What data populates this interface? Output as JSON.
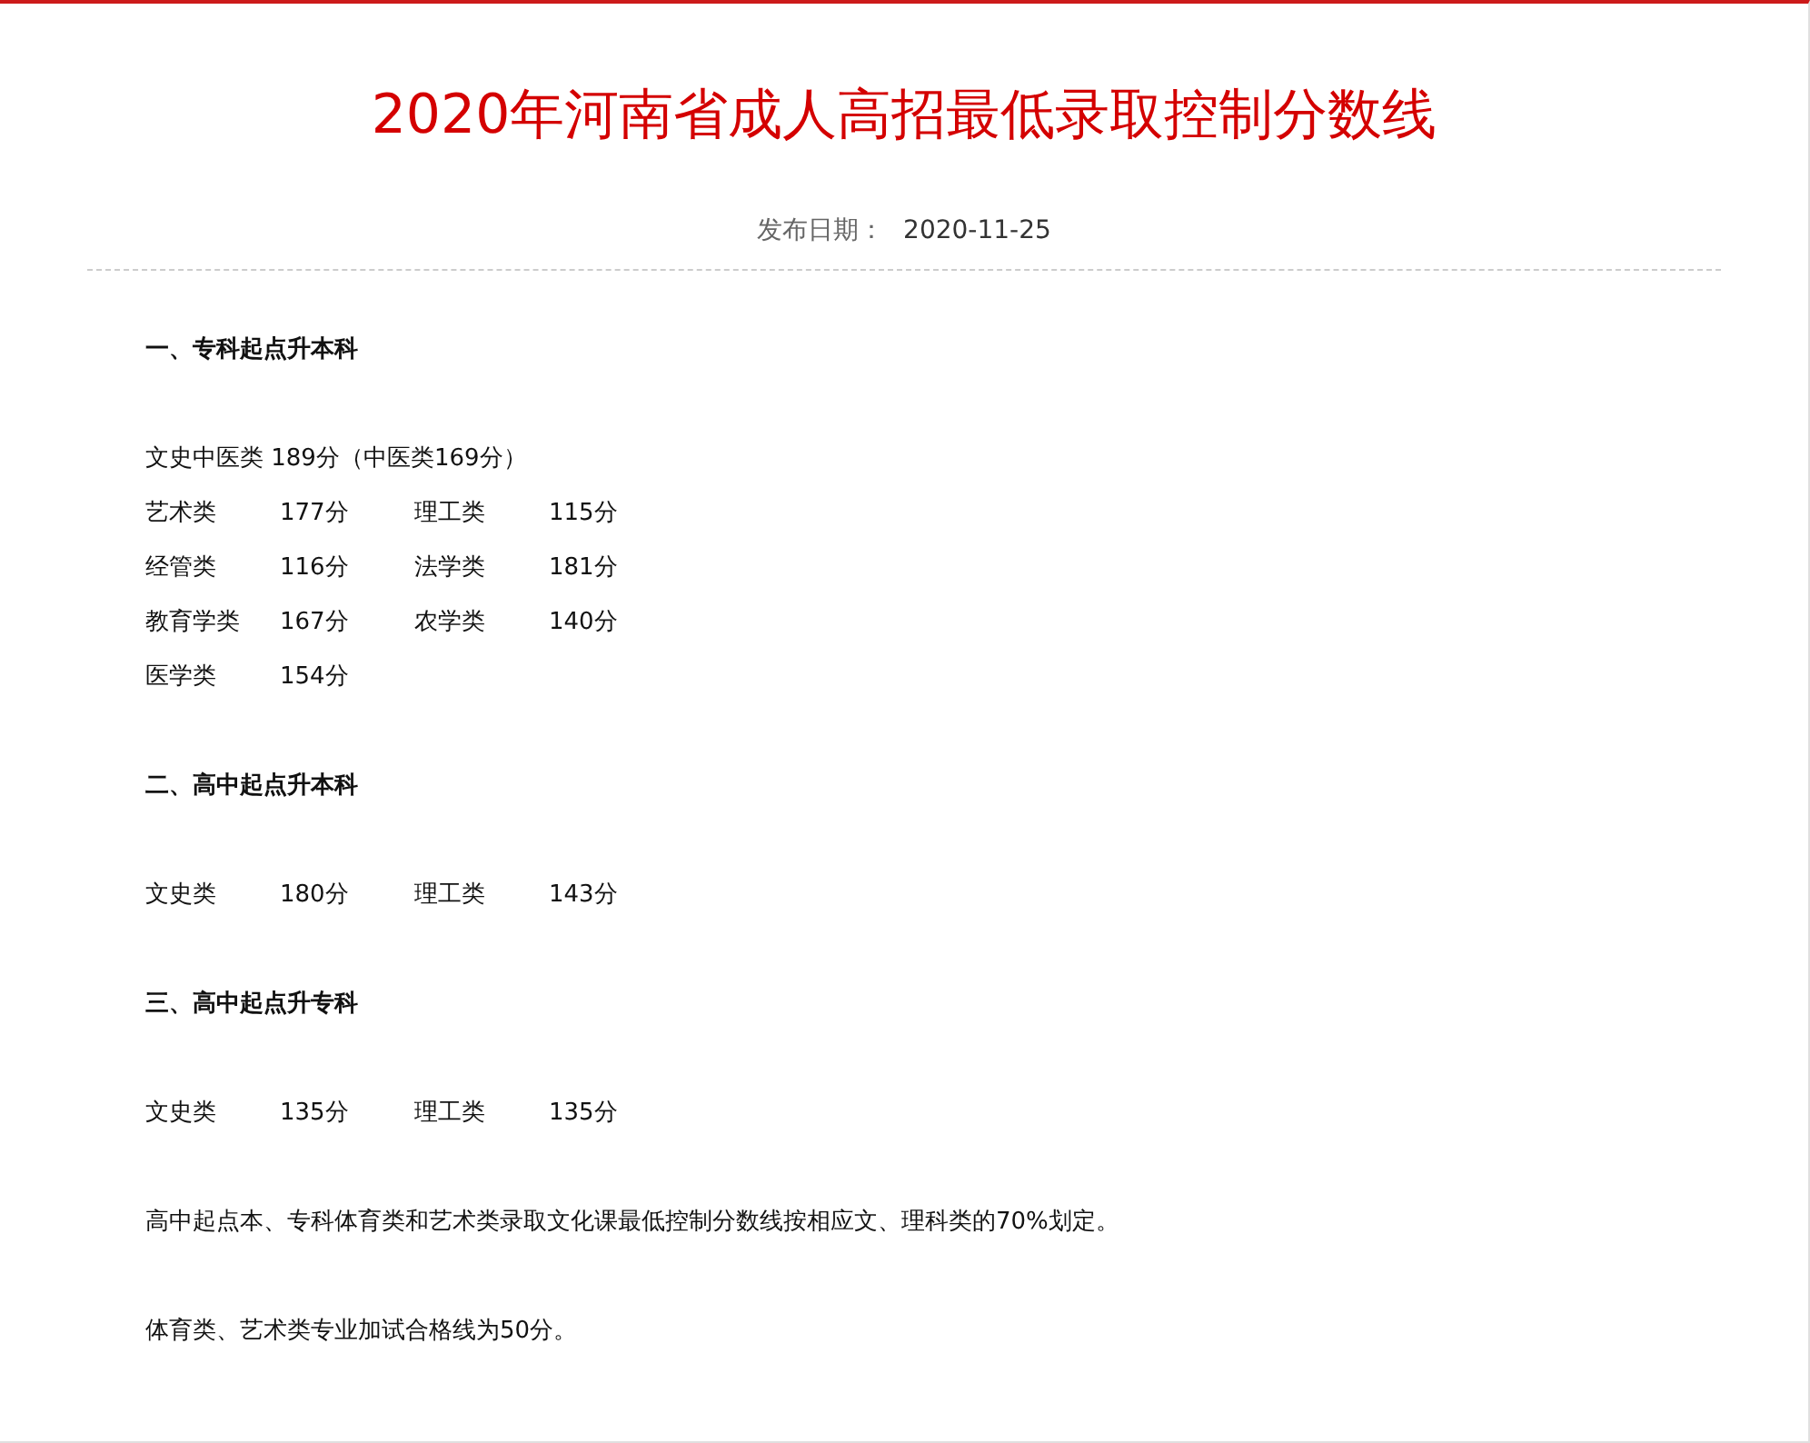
{
  "title": "2020年河南省成人高招最低录取控制分数线",
  "publish_label": "发布日期：",
  "publish_date": "2020-11-25",
  "sections": [
    {
      "heading": "一、专科起点升本科",
      "lines": [
        {
          "cells": [
            "文史中医类 189分（中医类169分）"
          ]
        },
        {
          "cells": [
            "艺术类",
            "177分",
            "理工类",
            "115分"
          ]
        },
        {
          "cells": [
            "经管类",
            "116分",
            "法学类",
            "181分"
          ]
        },
        {
          "cells": [
            "教育学类",
            "167分",
            "农学类",
            "140分"
          ]
        },
        {
          "cells": [
            "医学类",
            "154分"
          ]
        }
      ]
    },
    {
      "heading": "二、高中起点升本科",
      "lines": [
        {
          "cells": [
            "文史类",
            "180分",
            "理工类",
            "143分"
          ]
        }
      ]
    },
    {
      "heading": "三、高中起点升专科",
      "lines": [
        {
          "cells": [
            "文史类",
            "135分",
            "理工类",
            "135分"
          ]
        }
      ]
    }
  ],
  "notes": [
    "高中起点本、专科体育类和艺术类录取文化课最低控制分数线按相应文、理科类的70%划定。",
    "体育类、艺术类专业加试合格线为50分。"
  ]
}
